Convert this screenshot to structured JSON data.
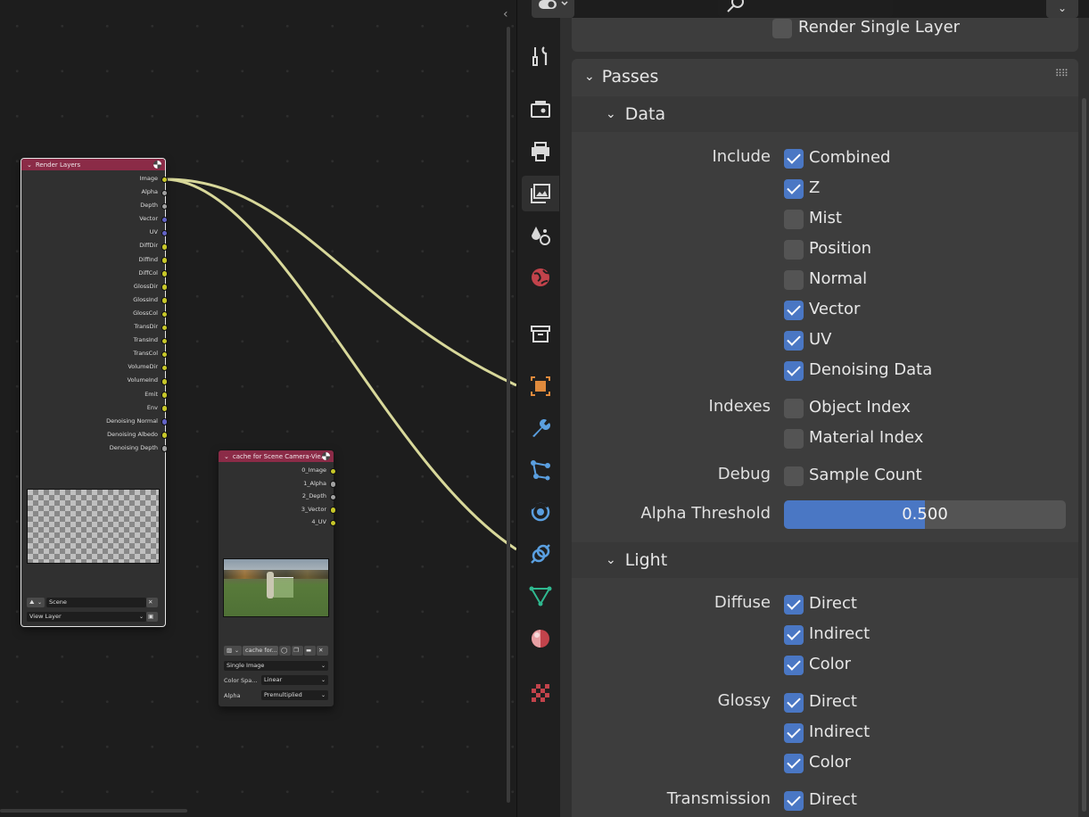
{
  "node_editor": {
    "render_layers_node": {
      "title": "Render Layers",
      "outputs": [
        {
          "label": "Image",
          "type": "color"
        },
        {
          "label": "Alpha",
          "type": "float"
        },
        {
          "label": "Depth",
          "type": "float"
        },
        {
          "label": "Vector",
          "type": "vector"
        },
        {
          "label": "UV",
          "type": "vector"
        },
        {
          "label": "DiffDir",
          "type": "color"
        },
        {
          "label": "DiffInd",
          "type": "color"
        },
        {
          "label": "DiffCol",
          "type": "color"
        },
        {
          "label": "GlossDir",
          "type": "color"
        },
        {
          "label": "GlossInd",
          "type": "color"
        },
        {
          "label": "GlossCol",
          "type": "color"
        },
        {
          "label": "TransDir",
          "type": "color"
        },
        {
          "label": "TransInd",
          "type": "color"
        },
        {
          "label": "TransCol",
          "type": "color"
        },
        {
          "label": "VolumeDir",
          "type": "color"
        },
        {
          "label": "VolumeInd",
          "type": "color"
        },
        {
          "label": "Emit",
          "type": "color"
        },
        {
          "label": "Env",
          "type": "color"
        },
        {
          "label": "Denoising Normal",
          "type": "vector"
        },
        {
          "label": "Denoising Albedo",
          "type": "color"
        },
        {
          "label": "Denoising Depth",
          "type": "float"
        }
      ],
      "scene_field": "Scene",
      "view_layer_field": "View Layer"
    },
    "image_node": {
      "title": "cache for Scene Camera-Vie...",
      "outputs": [
        {
          "label": "0_Image",
          "type": "color"
        },
        {
          "label": "1_Alpha",
          "type": "float"
        },
        {
          "label": "2_Depth",
          "type": "float"
        },
        {
          "label": "3_Vector",
          "type": "color"
        },
        {
          "label": "4_UV",
          "type": "color"
        }
      ],
      "image_name": "cache for...",
      "source": "Single Image",
      "color_space_label": "Color Spa...",
      "color_space_value": "Linear",
      "alpha_label": "Alpha",
      "alpha_value": "Premultiplied"
    }
  },
  "properties": {
    "render_single_layer": "Render Single Layer",
    "passes_header": "Passes",
    "data_header": "Data",
    "light_header": "Light",
    "data_rows": [
      {
        "label": "Include",
        "items": [
          {
            "text": "Combined",
            "checked": true
          },
          {
            "text": "Z",
            "checked": true
          },
          {
            "text": "Mist",
            "checked": false
          },
          {
            "text": "Position",
            "checked": false
          },
          {
            "text": "Normal",
            "checked": false
          },
          {
            "text": "Vector",
            "checked": true
          },
          {
            "text": "UV",
            "checked": true
          },
          {
            "text": "Denoising Data",
            "checked": true
          }
        ]
      },
      {
        "label": "Indexes",
        "items": [
          {
            "text": "Object Index",
            "checked": false
          },
          {
            "text": "Material Index",
            "checked": false
          }
        ]
      },
      {
        "label": "Debug",
        "items": [
          {
            "text": "Sample Count",
            "checked": false
          }
        ]
      }
    ],
    "alpha_threshold": {
      "label": "Alpha Threshold",
      "value": "0.500",
      "fraction": 0.5
    },
    "light_rows": [
      {
        "label": "Diffuse",
        "items": [
          {
            "text": "Direct",
            "checked": true
          },
          {
            "text": "Indirect",
            "checked": true
          },
          {
            "text": "Color",
            "checked": true
          }
        ]
      },
      {
        "label": "Glossy",
        "items": [
          {
            "text": "Direct",
            "checked": true
          },
          {
            "text": "Indirect",
            "checked": true
          },
          {
            "text": "Color",
            "checked": true
          }
        ]
      },
      {
        "label": "Transmission",
        "items": [
          {
            "text": "Direct",
            "checked": true
          }
        ]
      }
    ]
  },
  "tabs": [
    "tool-icon",
    "render-icon",
    "output-icon",
    "view-layer-icon",
    "scene-icon",
    "world-icon",
    "collection-icon",
    "object-icon",
    "modifier-icon",
    "particles-icon",
    "physics-icon",
    "constraints-icon",
    "object-data-icon",
    "material-icon",
    "texture-icon"
  ],
  "colors": {
    "accent": "#4a77c4",
    "node_header": "#8b2b47",
    "socket_color": "#c7c729",
    "socket_float": "#a1a1a1",
    "socket_vector": "#6363c7"
  }
}
